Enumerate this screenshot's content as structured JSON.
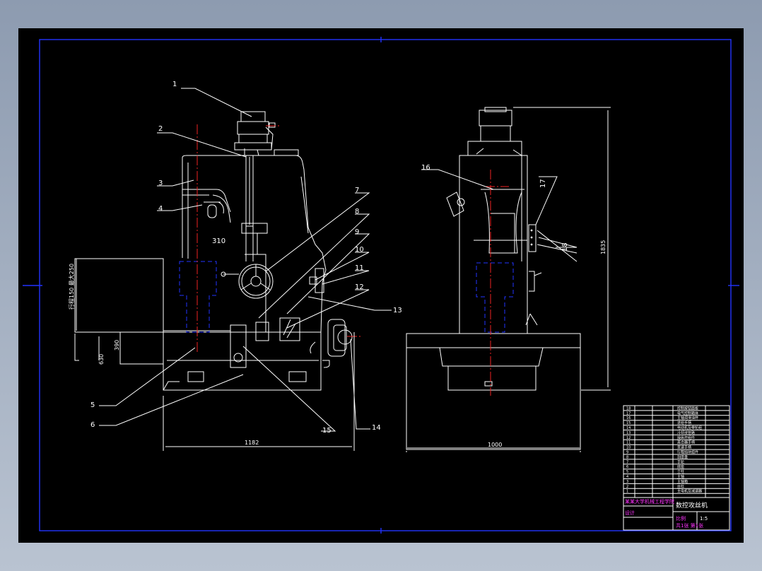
{
  "drawing": {
    "part_numbers": [
      "1",
      "2",
      "3",
      "4",
      "5",
      "6",
      "7",
      "8",
      "9",
      "10",
      "11",
      "12",
      "13",
      "14",
      "15",
      "16",
      "17",
      "18"
    ],
    "dimensions": {
      "throat_depth": "310",
      "front_width": "1182",
      "side_width": "1000",
      "overall_height": "1835",
      "table_height": "390",
      "base_height": "630",
      "stroke_note": "行程150 最大250"
    }
  },
  "title_block": {
    "drawing_name": "数控攻丝机",
    "company": "某某大学机械工程学院",
    "drawer": "设计",
    "scale_label": "比例",
    "scale": "1:5",
    "sheet": "共1张 第1张",
    "headers": [
      "序号",
      "代号",
      "名称",
      "数量",
      "备注"
    ]
  },
  "bom_rows": [
    {
      "no": "18",
      "name": "控制按钮面板"
    },
    {
      "no": "17",
      "name": "电气控制箱体"
    },
    {
      "no": "16",
      "name": "主轴润滑油杯"
    },
    {
      "no": "15",
      "name": "进给手柄"
    },
    {
      "no": "14",
      "name": "电动机及带轮组"
    },
    {
      "no": "13",
      "name": "冷却液管路"
    },
    {
      "no": "12",
      "name": "操纵杆组件"
    },
    {
      "no": "11",
      "name": "离合器手柄"
    },
    {
      "no": "10",
      "name": "变速手柄"
    },
    {
      "no": "9",
      "name": "行程挡块组件"
    },
    {
      "no": "8",
      "name": "刻度盘"
    },
    {
      "no": "7",
      "name": "手轮"
    },
    {
      "no": "6",
      "name": "底座"
    },
    {
      "no": "5",
      "name": "立柱"
    },
    {
      "no": "4",
      "name": "主轴"
    },
    {
      "no": "3",
      "name": "主轴箱"
    },
    {
      "no": "2",
      "name": "丝杠"
    },
    {
      "no": "1",
      "name": "主电机及减速器"
    }
  ],
  "colors": {
    "background": "#000000",
    "lines": "#ffffff",
    "center_lines": "#ee2222",
    "hidden_lines": "#2233ff",
    "title_text": "#ff33ff",
    "frame": "#2233ff"
  }
}
